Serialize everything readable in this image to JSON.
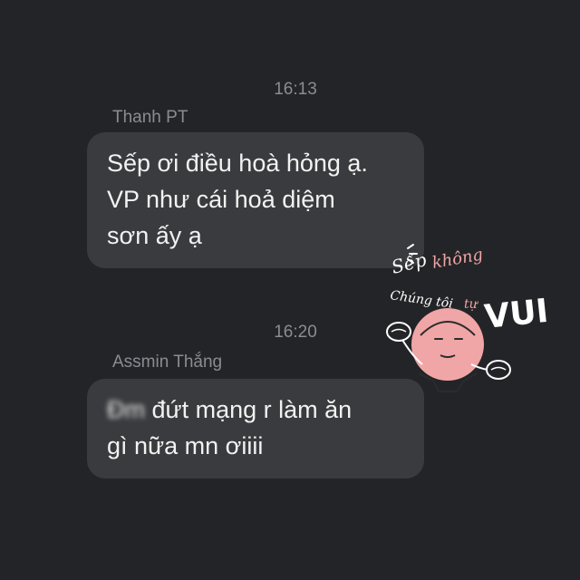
{
  "messages": [
    {
      "time": "16:13",
      "sender": "Thanh PT",
      "lines": [
        "Sếp ơi điều hoà hỏng ạ.",
        "VP như cái hoả diệm",
        "sơn ấy ạ"
      ]
    },
    {
      "time": "16:20",
      "sender": "Assmin Thắng",
      "censored_word": "Đm",
      "lines": [
        " đứt mạng r làm ăn",
        "gì nữa mn ơiiii"
      ]
    }
  ],
  "sticker": {
    "text_top": "Sếp",
    "text_pink": "không",
    "text_middle": "Chúng tôi",
    "text_pink2": "tự",
    "text_big": "VUI"
  },
  "colors": {
    "background": "#232427",
    "bubble": "#3a3b3e",
    "meta_text": "#8b8c91",
    "message_text": "#f2f2f2",
    "sticker_pink": "#f0a6a6"
  }
}
